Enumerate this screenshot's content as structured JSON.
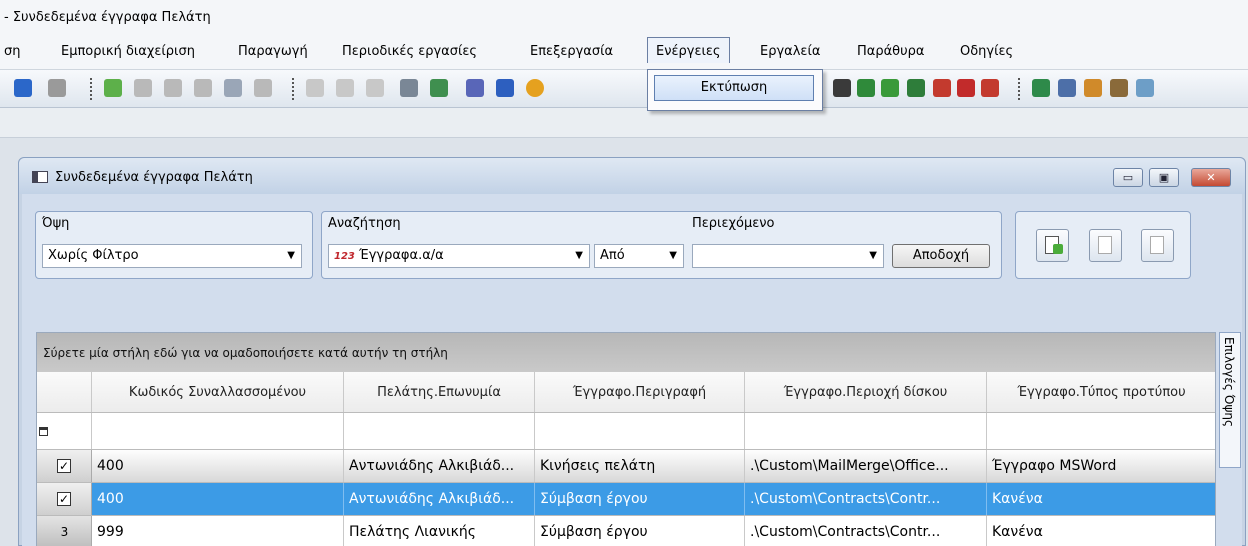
{
  "app": {
    "title": "- Συνδεδεμένα έγγραφα Πελάτη"
  },
  "menu": {
    "items": [
      "ση",
      "Εμπορική διαχείριση",
      "Παραγωγή",
      "Περιοδικές εργασίες",
      "Επεξεργασία",
      "Ενέργειες",
      "Εργαλεία",
      "Παράθυρα",
      "Οδηγίες"
    ],
    "open_item": "Ενέργειες",
    "dropdown": {
      "items": [
        "Εκτύπωση"
      ]
    }
  },
  "window": {
    "title": "Συνδεδεμένα έγγραφα Πελάτη",
    "controls": {
      "minimize": "▭",
      "restore": "▣",
      "close": "✕"
    }
  },
  "filters": {
    "view_label": "Όψη",
    "view_value": "Χωρίς Φίλτρο",
    "search_label": "Αναζήτηση",
    "search_field_value": "Έγγραφα.α/α",
    "search_field_prefix": "123",
    "operator_value": "Από",
    "content_label": "Περιεχόμενο",
    "content_value": "",
    "accept_label": "Αποδοχή"
  },
  "grid": {
    "group_hint": "Σύρετε μία στήλη εδώ για να ομαδοποιήσετε κατά αυτήν τη στήλη",
    "columns": [
      "Κωδικός Συναλλασσομένου",
      "Πελάτης.Επωνυμία",
      "Έγγραφο.Περιγραφή",
      "Έγγραφο.Περιοχή δίσκου",
      "Έγγραφο.Τύπος προτύπου"
    ],
    "rows": [
      {
        "checked": true,
        "num": "",
        "cells": [
          "400",
          "Αντωνιάδης Αλκιβιάδ...",
          "Κινήσεις πελάτη",
          ".\\Custom\\MailMerge\\Office...",
          "Έγγραφο MSWord"
        ]
      },
      {
        "checked": true,
        "num": "",
        "cells": [
          "400",
          "Αντωνιάδης Αλκιβιάδ...",
          "Σύμβαση έργου",
          ".\\Custom\\Contracts\\Contr...",
          "Κανένα"
        ]
      },
      {
        "checked": false,
        "num": "3",
        "cells": [
          "999",
          "Πελάτης Λιανικής",
          "Σύμβαση έργου",
          ".\\Custom\\Contracts\\Contr...",
          "Κανένα"
        ]
      }
    ],
    "side_tab": "Επιλογές Όψης"
  },
  "colors": {
    "selection": "#3c9be6",
    "window_frame": "#c6d3e4",
    "group_bar": "#c0c0c0"
  }
}
